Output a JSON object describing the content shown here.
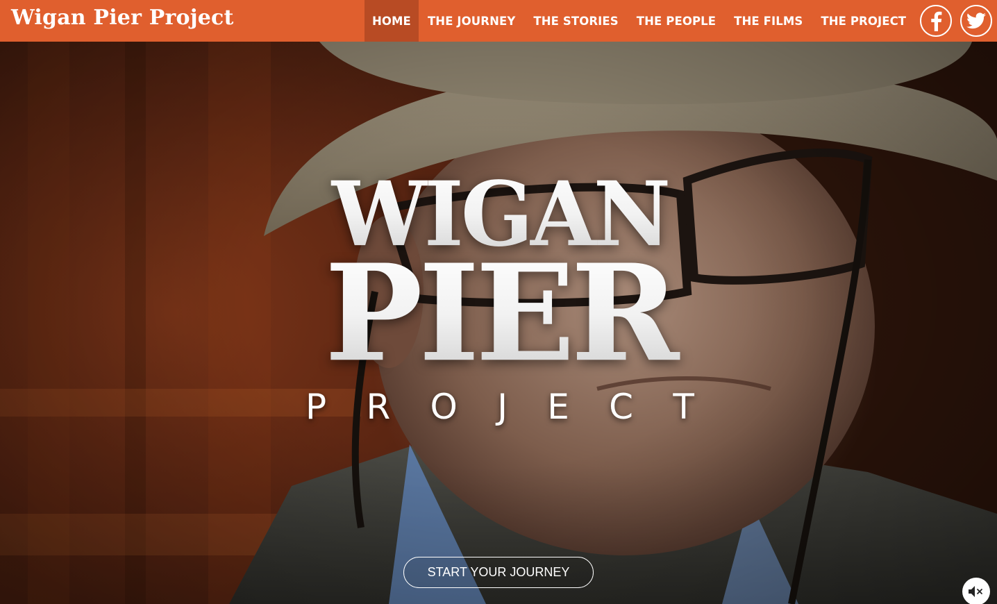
{
  "header": {
    "brand": "Wigan Pier Project",
    "colors": {
      "bar": "#e05f2e",
      "active": "#b84b24"
    },
    "nav": [
      {
        "label": "HOME",
        "active": true
      },
      {
        "label": "THE JOURNEY",
        "active": false
      },
      {
        "label": "THE STORIES",
        "active": false
      },
      {
        "label": "THE PEOPLE",
        "active": false
      },
      {
        "label": "THE FILMS",
        "active": false
      },
      {
        "label": "THE PROJECT",
        "active": false
      }
    ],
    "social": [
      {
        "icon": "facebook-icon"
      },
      {
        "icon": "twitter-icon"
      }
    ]
  },
  "hero": {
    "title_line1": "WIGAN",
    "title_line2": "PIER",
    "title_line3": [
      "P",
      "R",
      "O",
      "J",
      "E",
      "C",
      "T"
    ],
    "cta_label": "START YOUR JOURNEY",
    "mute_icon": "speaker-muted-icon"
  }
}
